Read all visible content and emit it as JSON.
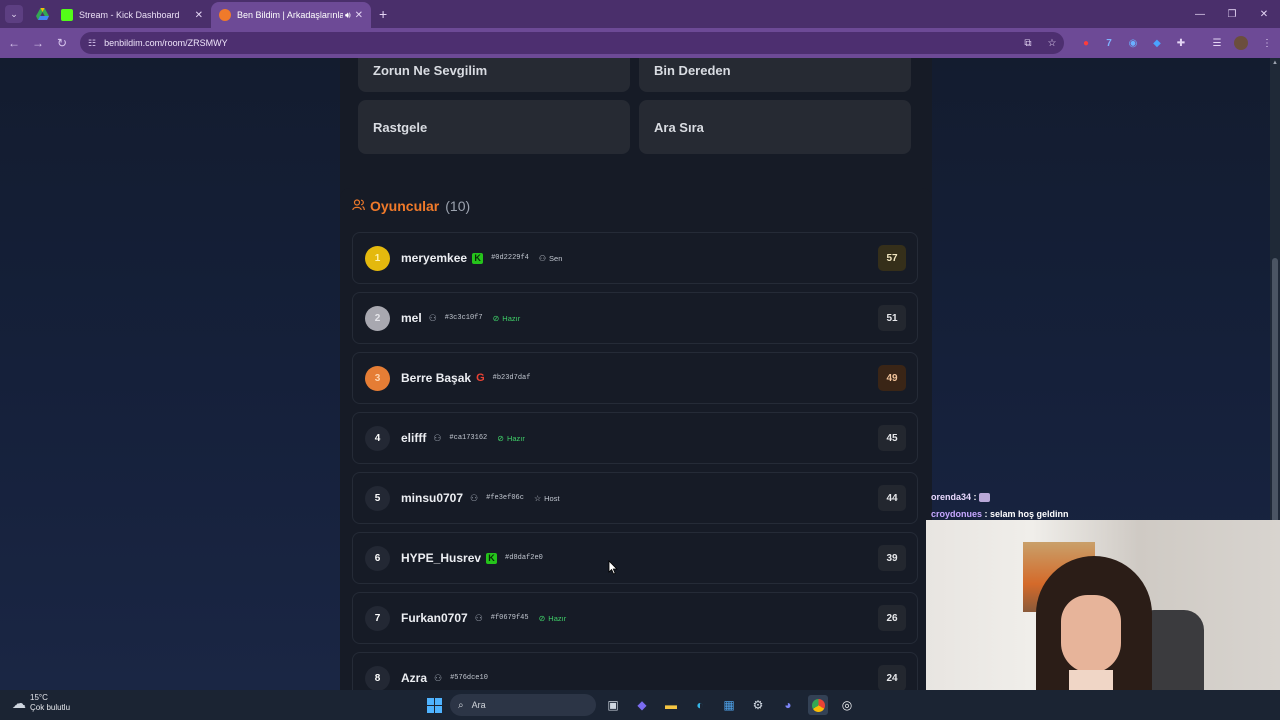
{
  "browser": {
    "tabs": [
      {
        "title": "Stream - Kick Dashboard",
        "active": false,
        "favicon_color": "#53fc18"
      },
      {
        "title": "Ben Bildim | Arkadaşlarınla",
        "active": true,
        "favicon_color": "#f07a2a"
      }
    ],
    "url": "benbildim.com/room/ZRSMWY"
  },
  "categories": [
    "Zorun Ne Sevgilim",
    "Bin Dereden",
    "Rastgele",
    "Ara Sıra"
  ],
  "players_section": {
    "title": "Oyuncular",
    "count": "(10)",
    "players": [
      {
        "rank": "1",
        "name": "meryemkee",
        "badge": "kick",
        "id": "#0d2229f4",
        "status": "Sen",
        "status_type": "plain",
        "score": "57"
      },
      {
        "rank": "2",
        "name": "mel",
        "badge": "user",
        "id": "#3c3c10f7",
        "status": "Hazır",
        "status_type": "ready",
        "score": "51"
      },
      {
        "rank": "3",
        "name": "Berre Başak",
        "badge": "google",
        "id": "#b23d7daf",
        "status": "",
        "status_type": "none",
        "score": "49"
      },
      {
        "rank": "4",
        "name": "elifff",
        "badge": "user",
        "id": "#ca173162",
        "status": "Hazır",
        "status_type": "ready",
        "score": "45"
      },
      {
        "rank": "5",
        "name": "minsu0707",
        "badge": "user",
        "id": "#fe3ef06c",
        "status": "Host",
        "status_type": "plain",
        "score": "44"
      },
      {
        "rank": "6",
        "name": "HYPE_Husrev",
        "badge": "kick",
        "id": "#d8daf2e0",
        "status": "",
        "status_type": "none",
        "score": "39"
      },
      {
        "rank": "7",
        "name": "Furkan0707",
        "badge": "user",
        "id": "#f0679f45",
        "status": "Hazır",
        "status_type": "ready",
        "score": "26"
      },
      {
        "rank": "8",
        "name": "Azra",
        "badge": "user",
        "id": "#576dce10",
        "status": "",
        "status_type": "none",
        "score": "24"
      }
    ]
  },
  "chat": [
    {
      "user": "orenda34",
      "sep": " :",
      "message": ""
    },
    {
      "user": "croydonues",
      "sep": " :",
      "message": " selam hoş geldinn"
    }
  ],
  "taskbar": {
    "temperature": "15°C",
    "weather": "Çok bulutlu",
    "search_placeholder": "Ara"
  }
}
